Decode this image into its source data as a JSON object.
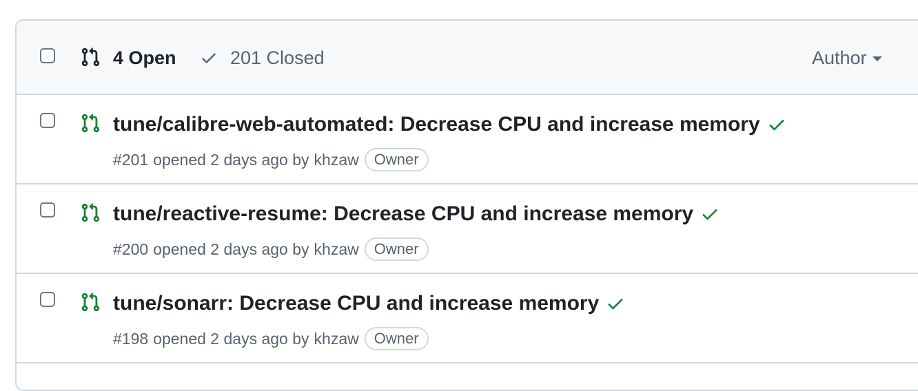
{
  "header": {
    "open_count_label": "4 Open",
    "closed_count_label": "201 Closed",
    "author_filter_label": "Author",
    "icons": {
      "open": "git-pull-request-icon",
      "closed": "check-icon",
      "author": "triangle-down-icon"
    }
  },
  "pull_requests": [
    {
      "title": "tune/calibre-web-automated: Decrease CPU and increase memory",
      "number": "#201",
      "opened_text": "opened 2 days ago by",
      "author": "khzaw",
      "badge": "Owner",
      "status": "check-success"
    },
    {
      "title": "tune/reactive-resume: Decrease CPU and increase memory",
      "number": "#200",
      "opened_text": "opened 2 days ago by",
      "author": "khzaw",
      "badge": "Owner",
      "status": "check-success"
    },
    {
      "title": "tune/sonarr: Decrease CPU and increase memory",
      "number": "#198",
      "opened_text": "opened 2 days ago by",
      "author": "khzaw",
      "badge": "Owner",
      "status": "check-success"
    }
  ],
  "colors": {
    "open_pr_green": "#1a7f37",
    "muted_text": "#59636e",
    "border": "#d1d9e0",
    "header_bg": "#f6f8fa"
  }
}
